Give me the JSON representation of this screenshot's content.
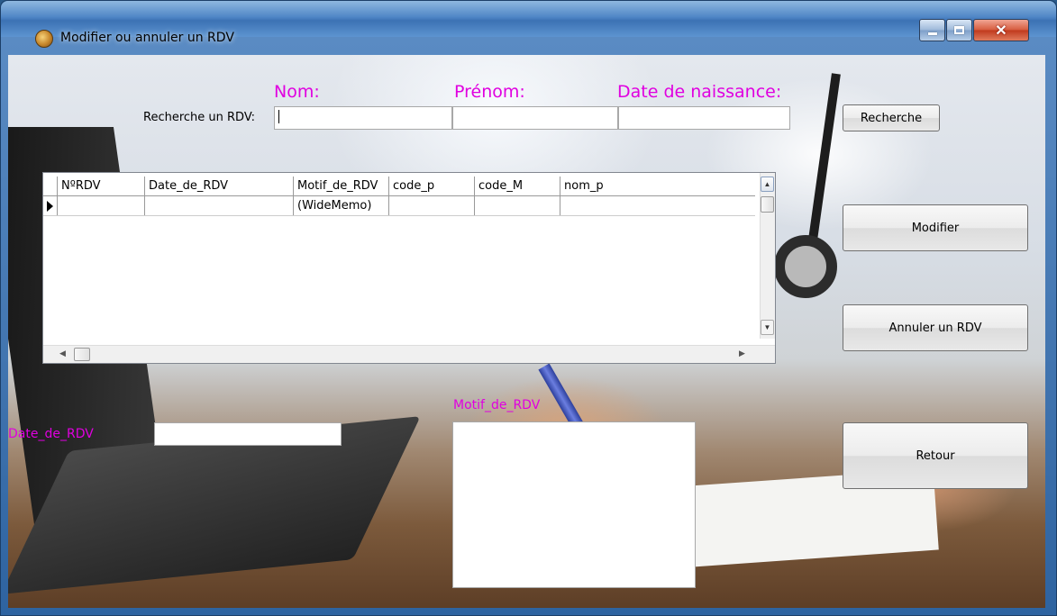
{
  "window": {
    "title": "Modifier ou annuler un RDV"
  },
  "search": {
    "label": "Recherche un RDV:",
    "headers": {
      "nom": "Nom:",
      "prenom": "Prénom:",
      "date_naissance": "Date de naissance:"
    },
    "button_label": "Recherche"
  },
  "grid": {
    "columns": [
      "NºRDV",
      "Date_de_RDV",
      "Motif_de_RDV",
      "code_p",
      "code_M",
      "nom_p"
    ],
    "rows": [
      [
        "",
        "",
        "(WideMemo)",
        "",
        "",
        ""
      ]
    ]
  },
  "actions": {
    "modifier": "Modifier",
    "annuler": "Annuler un RDV",
    "retour": "Retour"
  },
  "form": {
    "date_label": "Date_de_RDV",
    "motif_label": "Motif_de_RDV"
  },
  "colors": {
    "label_accent": "#e000e0"
  }
}
